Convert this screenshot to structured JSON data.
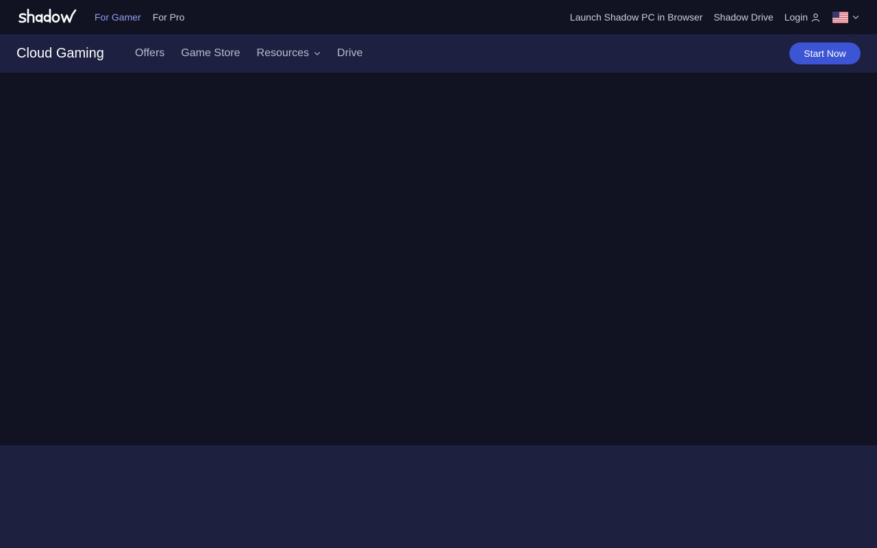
{
  "colors": {
    "background_dark": "#111322",
    "nav_background": "#1d2040",
    "lower_section": "#1d203f",
    "accent_link": "#8f9ff0",
    "cta_blue": "#3b55d4",
    "muted_text": "#b8bccc"
  },
  "logo": {
    "text": "shadow",
    "icon": "shadow-logo"
  },
  "topbar": {
    "left_links": [
      {
        "label": "For Gamer",
        "active": true
      },
      {
        "label": "For Pro",
        "active": false
      }
    ],
    "right_links": [
      {
        "label": "Launch Shadow PC in Browser"
      },
      {
        "label": "Shadow Drive"
      }
    ],
    "login": {
      "label": "Login",
      "icon": "user-icon"
    },
    "language": {
      "icon": "us-flag-icon",
      "dropdown_icon": "chevron-down-icon"
    }
  },
  "mainnav": {
    "brand": "Cloud Gaming",
    "links": [
      {
        "label": "Offers",
        "has_dropdown": false
      },
      {
        "label": "Game Store",
        "has_dropdown": false
      },
      {
        "label": "Resources",
        "has_dropdown": true
      },
      {
        "label": "Drive",
        "has_dropdown": false
      }
    ],
    "cta": "Start Now"
  }
}
